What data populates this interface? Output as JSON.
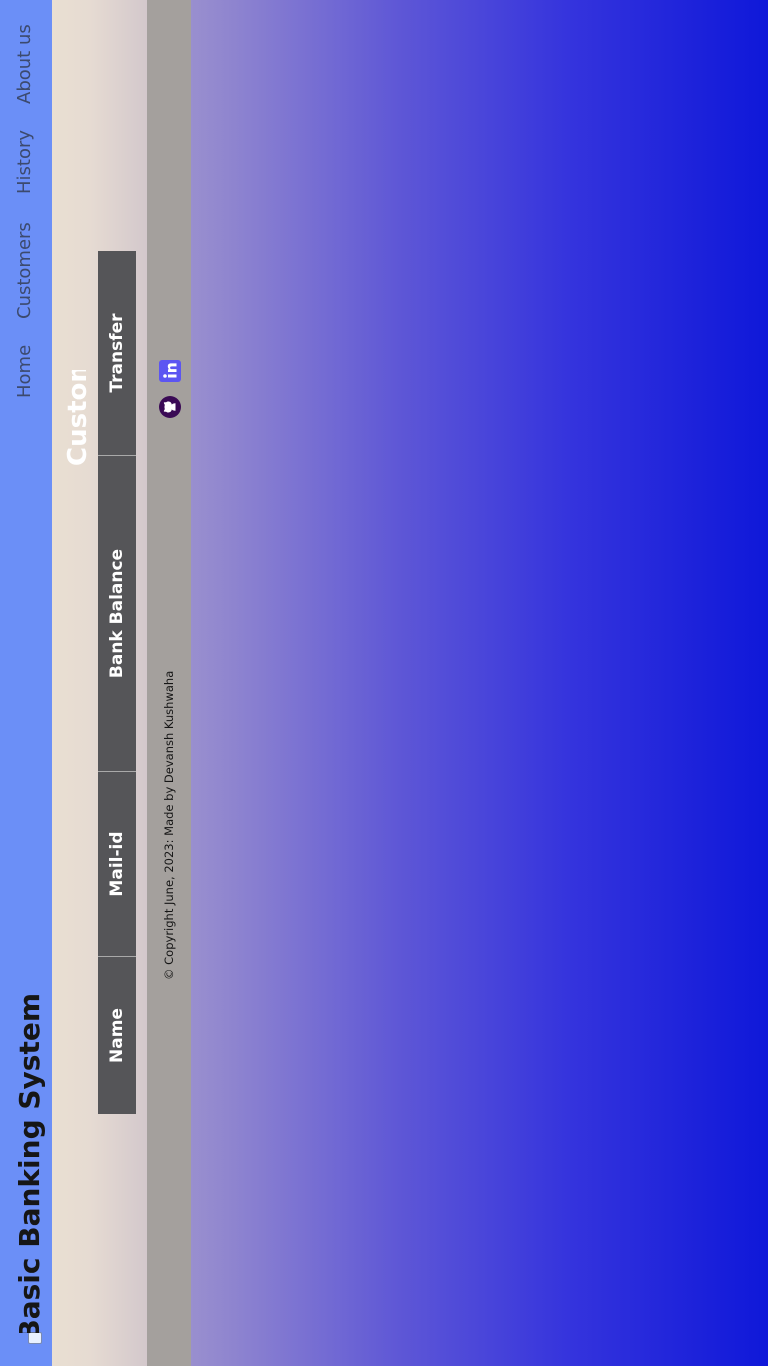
{
  "navbar": {
    "brand": "TSF Basic Banking System",
    "brand_icon": "bank-logo-icon",
    "links": [
      "Home",
      "Customers",
      "History",
      "About us"
    ]
  },
  "main": {
    "title": "Customers",
    "table": {
      "headers": [
        "Name",
        "Mail-id",
        "Bank Balance",
        "Transfer"
      ]
    }
  },
  "footer": {
    "copyright": "© Copyright June, 2023: Made by Devansh Kushwaha",
    "social_icons": [
      "github-icon",
      "linkedin-icon"
    ]
  },
  "colors": {
    "navbar": "#6b8ff7",
    "table_header": "#555558",
    "footer": "#a4a09d",
    "gradient_end": "#0f18d9"
  }
}
